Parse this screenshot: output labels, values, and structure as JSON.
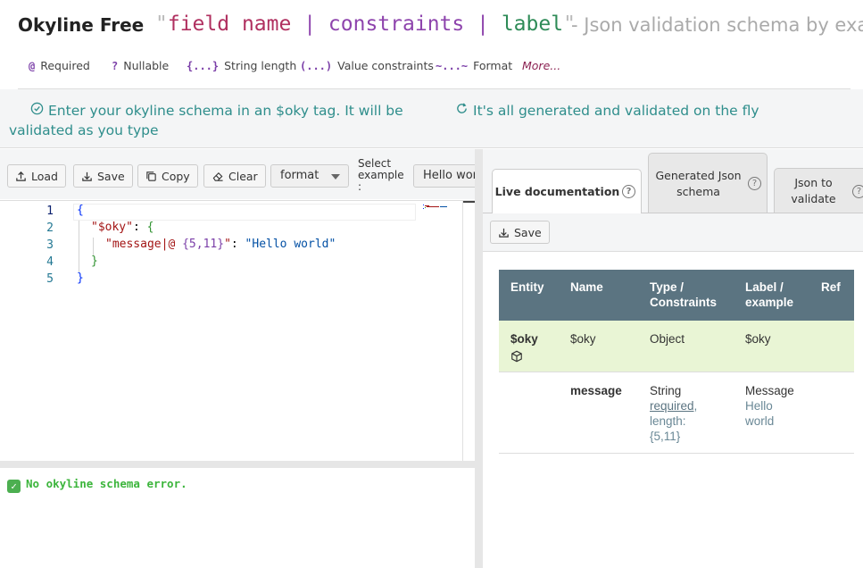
{
  "header": {
    "app_title": "Okyline Free",
    "tagline_open_quote": "\"",
    "tagline_field": "field name",
    "tagline_pipe": "|",
    "tagline_constraints": "constraints",
    "tagline_label": "label",
    "tagline_close_quote": "\"",
    "subtitle": "-  Json validation schema by example"
  },
  "legend": [
    {
      "symbol": "@",
      "label": "Required"
    },
    {
      "symbol": "?",
      "label": "Nullable"
    },
    {
      "symbol": "{...}",
      "label": "String length"
    },
    {
      "symbol": "(...)",
      "label": "Value constraints"
    },
    {
      "symbol": "~...~",
      "label": "Format"
    }
  ],
  "legend_more": "More...",
  "info": {
    "message_1": "Enter your okyline schema in an $oky tag. It will be validated as you type",
    "message_2": "It's all generated and validated on the fly"
  },
  "toolbar": {
    "load": "Load",
    "save": "Save",
    "copy": "Copy",
    "clear": "Clear",
    "format_select": "format",
    "select_example_label": "Select example :",
    "example_select": "Hello world"
  },
  "editor": {
    "line_numbers": [
      "1",
      "2",
      "3",
      "4",
      "5"
    ],
    "line1": "{",
    "line2_key": "\"$oky\"",
    "line2_colon": ": ",
    "line2_brace": "{",
    "line3_key_start": "\"message|@ ",
    "line3_cons": "{5,11}",
    "line3_key_end": "\"",
    "line3_colon": ": ",
    "line3_val": "\"Hello world\"",
    "line4": "}",
    "line5": "}"
  },
  "status": {
    "icon": "✓",
    "message": "No okyline schema error."
  },
  "right_tabs": {
    "live": "Live documentation",
    "generated": "Generated Json schema",
    "json": "Json to validate",
    "help": "?"
  },
  "right_save": "Save",
  "doc_table": {
    "headers": [
      "Entity",
      "Name",
      "Type / Constraints",
      "Label / example",
      "Ref"
    ],
    "row1": {
      "entity": "$oky",
      "name": "$oky",
      "type": "Object",
      "label": "$oky",
      "ref": ""
    },
    "row2": {
      "entity": "",
      "name": "message",
      "type": "String",
      "required": "required",
      "length_label": ", length:",
      "length": "{5,11}",
      "label": "Message",
      "example": "Hello world",
      "ref": ""
    }
  },
  "colors": {
    "accent_teal": "#2f8e8c",
    "header_table": "#5b7481",
    "row_highlight": "#e9f5d5",
    "ok_green": "#3cb53c",
    "constraint_purple": "#7b3fa8",
    "field_red": "#b03060",
    "label_green": "#2e8b57"
  }
}
